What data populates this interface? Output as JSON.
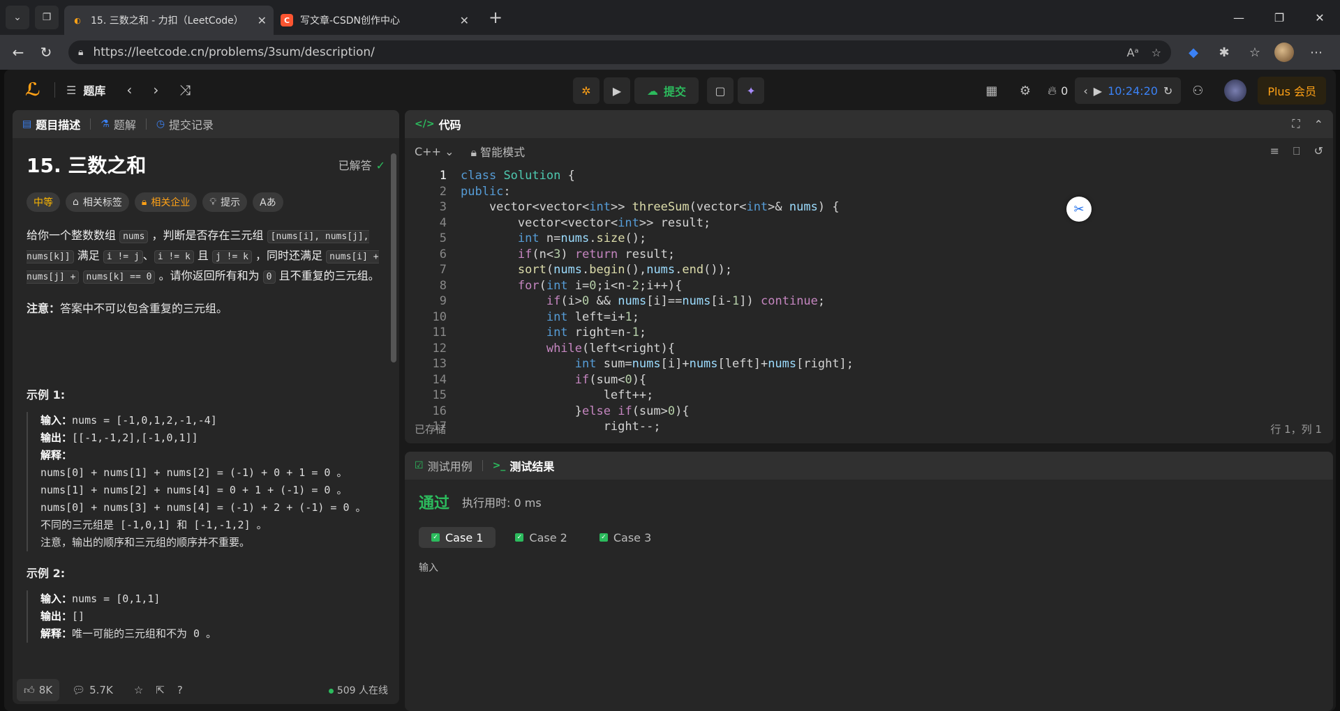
{
  "browser": {
    "tabs": [
      {
        "title": "15. 三数之和 - 力扣（LeetCode）",
        "active": true
      },
      {
        "title": "写文章-CSDN创作中心",
        "active": false
      }
    ],
    "url": "https://leetcode.cn/problems/3sum/description/"
  },
  "nav": {
    "problem_list": "题库",
    "submit": "提交",
    "streak": "0",
    "timer": "10:24:20",
    "plus": "Plus 会员"
  },
  "desc_panel": {
    "tabs": [
      "题目描述",
      "题解",
      "提交记录"
    ],
    "title": "15. 三数之和",
    "solved": "已解答",
    "tags": [
      "中等",
      "相关标签",
      "相关企业",
      "提示",
      "Aあ"
    ],
    "p1a": "给你一个整数数组",
    "c_nums": "nums",
    "p1b": "，判断是否存在三元组",
    "c_triple": "[nums[i], nums[j], nums[k]]",
    "p1c": "满足",
    "c_ij": "i != j",
    "p1d": "、",
    "c_ik": "i != k",
    "p1e": "且",
    "c_jk": "j != k",
    "p1f": "，同时还满足",
    "c_sum": "nums[i] + nums[j] +",
    "c_sum2": "nums[k] == 0",
    "p1g": "。请你返回所有和为",
    "c_zero": "0",
    "p1h": "且不重复的三元组。",
    "note_b": "注意：",
    "note": "答案中不可以包含重复的三元组。",
    "ex1_title": "示例 1:",
    "ex1_in_lbl": "输入：",
    "ex1_in": "nums = [-1,0,1,2,-1,-4]",
    "ex1_out_lbl": "输出：",
    "ex1_out": "[[-1,-1,2],[-1,0,1]]",
    "ex1_exp_lbl": "解释：",
    "ex1_lines": [
      "nums[0] + nums[1] + nums[2] = (-1) + 0 + 1 = 0 。",
      "nums[1] + nums[2] + nums[4] = 0 + 1 + (-1) = 0 。",
      "nums[0] + nums[3] + nums[4] = (-1) + 2 + (-1) = 0 。",
      "不同的三元组是 [-1,0,1] 和 [-1,-1,2] 。",
      "注意，输出的顺序和三元组的顺序并不重要。"
    ],
    "ex2_title": "示例 2:",
    "ex2_in_lbl": "输入：",
    "ex2_in": "nums = [0,1,1]",
    "ex2_out_lbl": "输出：",
    "ex2_out": "[]",
    "ex2_exp_lbl": "解释：",
    "ex2_exp": "唯一可能的三元组和不为 0 。",
    "likes": "8K",
    "comments": "5.7K",
    "online": "509 人在线"
  },
  "code_panel": {
    "title": "代码",
    "lang": "C++",
    "mode": "智能模式",
    "saved": "已存储",
    "cursor": "行 1，列 1",
    "lines": [
      "class Solution {",
      "public:",
      "    vector<vector<int>> threeSum(vector<int>& nums) {",
      "        vector<vector<int>> result;",
      "        int n=nums.size();",
      "        if(n<3) return result;",
      "        sort(nums.begin(),nums.end());",
      "        for(int i=0;i<n-2;i++){",
      "            if(i>0 && nums[i]==nums[i-1]) continue;",
      "            int left=i+1;",
      "            int right=n-1;",
      "            while(left<right){",
      "                int sum=nums[i]+nums[left]+nums[right];",
      "                if(sum<0){",
      "                    left++;",
      "                }else if(sum>0){",
      "                    right--;"
    ]
  },
  "test_panel": {
    "tabs": [
      "测试用例",
      "测试结果"
    ],
    "status": "通过",
    "runtime": "执行用时: 0 ms",
    "cases": [
      "Case 1",
      "Case 2",
      "Case 3"
    ],
    "input_label": "输入"
  }
}
